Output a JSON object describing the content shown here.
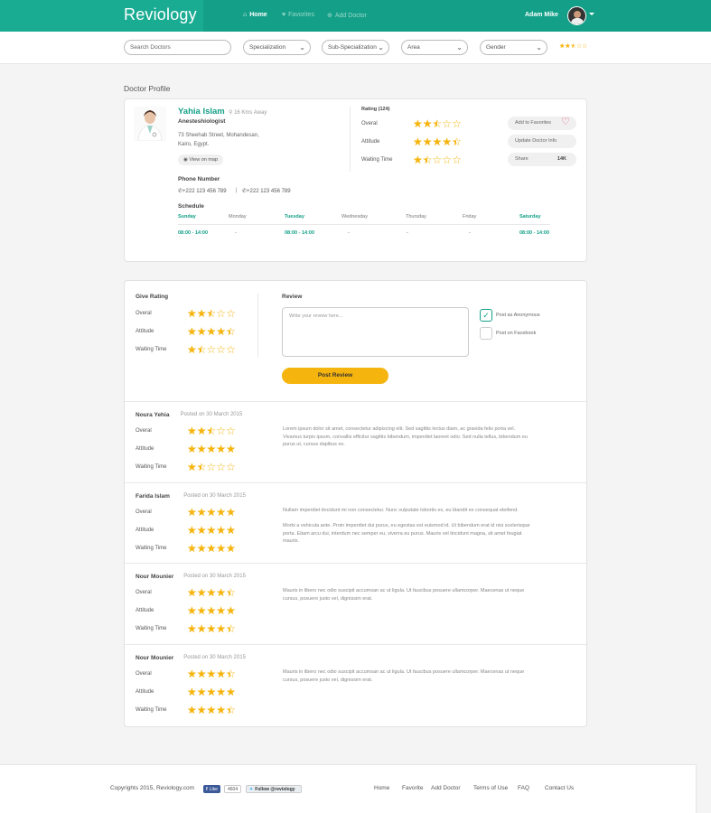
{
  "header": {
    "logo": "Reviology",
    "nav": [
      {
        "label": "Home",
        "icon": "home-icon"
      },
      {
        "label": "Favorites",
        "icon": "heart-icon"
      },
      {
        "label": "Add Doctor",
        "icon": "plus-circle-icon"
      }
    ],
    "user_name": "Adam Mike"
  },
  "filters": {
    "search_placeholder": "Search Doctors",
    "specialization": "Specialization",
    "sub_specialization": "Sub-Specialization",
    "area": "Area",
    "gender": "Gender",
    "rating_value": 2.5
  },
  "profile": {
    "section_title": "Doctor Profile",
    "name": "Yahia Islam",
    "distance": "16 Kms Away",
    "specialty": "Anesteshiologist",
    "address_line1": "73 Sheehab Street, Mohandesan,",
    "address_line2": "Kairo, Egypt.",
    "map_button": "View on map",
    "phone_title": "Phone Number",
    "phone1": "+222 123 456 789",
    "separator": "|",
    "phone2": "+222 123 456 789",
    "schedule_title": "Schedule",
    "schedule": [
      {
        "day": "Sunday",
        "time": "08:00 - 14:00",
        "active": true
      },
      {
        "day": "Monday",
        "time": "-",
        "active": false
      },
      {
        "day": "Tuesday",
        "time": "08:00 - 14:00",
        "active": true
      },
      {
        "day": "Wednesday",
        "time": "-",
        "active": false
      },
      {
        "day": "Thursday",
        "time": "-",
        "active": false
      },
      {
        "day": "Friday",
        "time": "-",
        "active": false
      },
      {
        "day": "Saturday",
        "time": "08:00 - 14:00",
        "active": true
      }
    ],
    "rating_title": "Rating (124)",
    "ratings": [
      {
        "label": "Overal",
        "value": 2.5
      },
      {
        "label": "Attitude",
        "value": 4.5
      },
      {
        "label": "Waiting Time",
        "value": 1.5
      }
    ],
    "actions": {
      "favorites": "Add to Favorites",
      "update": "Update Doctor Info",
      "share": "Share",
      "share_count": "14K"
    }
  },
  "give_rating": {
    "title": "Give Rating",
    "ratings": [
      {
        "label": "Overal",
        "value": 2.5
      },
      {
        "label": "Attitude",
        "value": 4.5
      },
      {
        "label": "Waiting Time",
        "value": 1.5
      }
    ],
    "review_title": "Review",
    "review_placeholder": "Write your review here...",
    "post_anonymous": "Post as Anonymous",
    "post_facebook": "Post on Facebook",
    "post_button": "Post Review"
  },
  "reviews": [
    {
      "name": "Noura Yehia",
      "date": "Posted on 30 March 2015",
      "ratings": [
        {
          "label": "Overal",
          "value": 2.5
        },
        {
          "label": "Attitude",
          "value": 5
        },
        {
          "label": "Waiting Time",
          "value": 1.5
        }
      ],
      "text1": "Lorem ipsum dolor sit amet, consectetur adipiscing elit. Sed sagittis lectus diam, ac gravida felis porta vel. Vivamus turpis ipsum, convallis efficitur sagittis bibendum, imperdiet laoreet odio. Sed nulla tellus, bibendum eu purus ut, cursus dapibus ex.",
      "text2": ""
    },
    {
      "name": "Farida Islam",
      "date": "Posted on 30 March 2015",
      "ratings": [
        {
          "label": "Overal",
          "value": 5
        },
        {
          "label": "Attitude",
          "value": 5
        },
        {
          "label": "Waiting Time",
          "value": 5
        }
      ],
      "text1": "Nullam imperdiet tincidunt mi non consectetur. Nunc vulputate lobortis ex, eu blandit ex consequat eleifend.",
      "text2": "Morbi a vehicula ante. Proin imperdiet dui purus, eu egestas est euismod id. Ut bibendum erat id nisi scelerisque porta. Etiam arcu dui, interdum nec semper eu, viverra eu purus. Mauris vel tincidunt magna, sit amet feugiat mauris."
    },
    {
      "name": "Nour Mounier",
      "date": "Posted on 30 March 2015",
      "ratings": [
        {
          "label": "Overal",
          "value": 4.5
        },
        {
          "label": "Attitude",
          "value": 5
        },
        {
          "label": "Waiting Time",
          "value": 4.5
        }
      ],
      "text1": "Mauris in libero nec odio suscipit accumsan ac ut ligula. Ut faucibus posuere ullamcorper. Maecenas ut neque cursus, posuere justo vel, dignissim erat.",
      "text2": ""
    },
    {
      "name": "Nour Mounier",
      "date": "Posted on 30 March 2015",
      "ratings": [
        {
          "label": "Overal",
          "value": 4.5
        },
        {
          "label": "Attitude",
          "value": 5
        },
        {
          "label": "Waiting Time",
          "value": 4.5
        }
      ],
      "text1": "Mauris in libero nec odio suscipit accumsan ac ut ligula. Ut faucibus posuere ullamcorper. Maecenas ut neque cursus, posuere justo vel, dignissim erat.",
      "text2": ""
    }
  ],
  "footer": {
    "copyright": "Copyrights 2015, Reviology.com",
    "fb_like": "Like",
    "fb_count": "4604",
    "twitter": "Follow @reviology",
    "links": [
      "Home",
      "Favorite",
      "Add Doctor",
      "Terms of Use",
      "FAQ",
      "Contact Us"
    ]
  },
  "colors": {
    "accent": "#14a088",
    "star": "#f6b40e"
  }
}
